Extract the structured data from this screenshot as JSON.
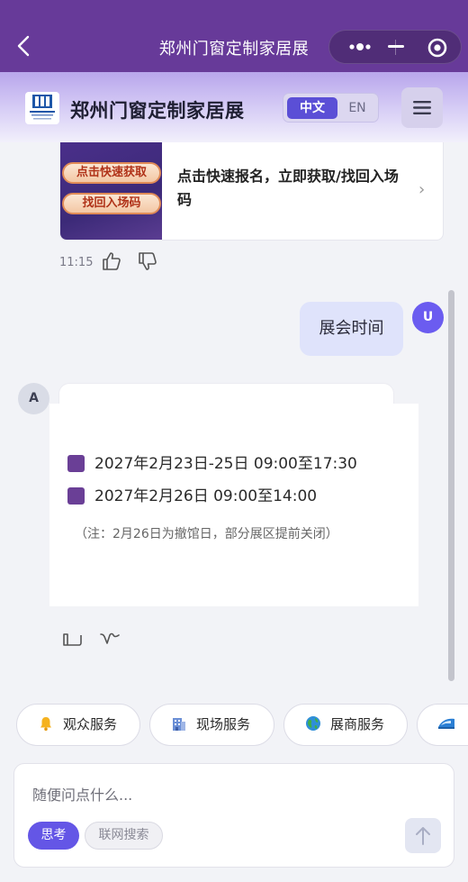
{
  "navbar": {
    "title": "郑州门窗定制家居展",
    "icons": [
      "back-icon",
      "more-icon",
      "minimize-icon",
      "close-target-icon"
    ]
  },
  "header": {
    "logo_icon": "hindoor-logo",
    "brand": "郑州门窗定制家居展",
    "lang_zh": "中文",
    "lang_en": "EN",
    "menu_icon": "hamburger-icon"
  },
  "promo": {
    "badge_top": "点击快速获取",
    "badge_bottom": "找回入场码",
    "text": "点击快速报名，立即获取/找回入场码",
    "arrow": "›"
  },
  "messages": {
    "bot_time": "11:15",
    "user_avatar": "U",
    "user_text": "展会时间",
    "bot_avatar": "A",
    "schedule": [
      "2027年2月23日-25日  09:00至17:30",
      "2027年2月26日  09:00至14:00"
    ],
    "note": "（注：2月26日为撤馆日，部分展区提前关闭）"
  },
  "chips": [
    {
      "icon": "bell-icon",
      "label": "观众服务"
    },
    {
      "icon": "building-icon",
      "label": "现场服务"
    },
    {
      "icon": "globe-icon",
      "label": "展商服务"
    },
    {
      "icon": "train-icon",
      "label": ""
    }
  ],
  "composer": {
    "placeholder": "随便问点什么...",
    "think": "思考",
    "web_search": "联网搜索",
    "send_icon": "arrow-up-icon"
  },
  "colors": {
    "navbar": "#673a99",
    "accent": "#5b4fd6",
    "bullet": "#6a3f96",
    "user_bubble": "#dfe3fb"
  }
}
